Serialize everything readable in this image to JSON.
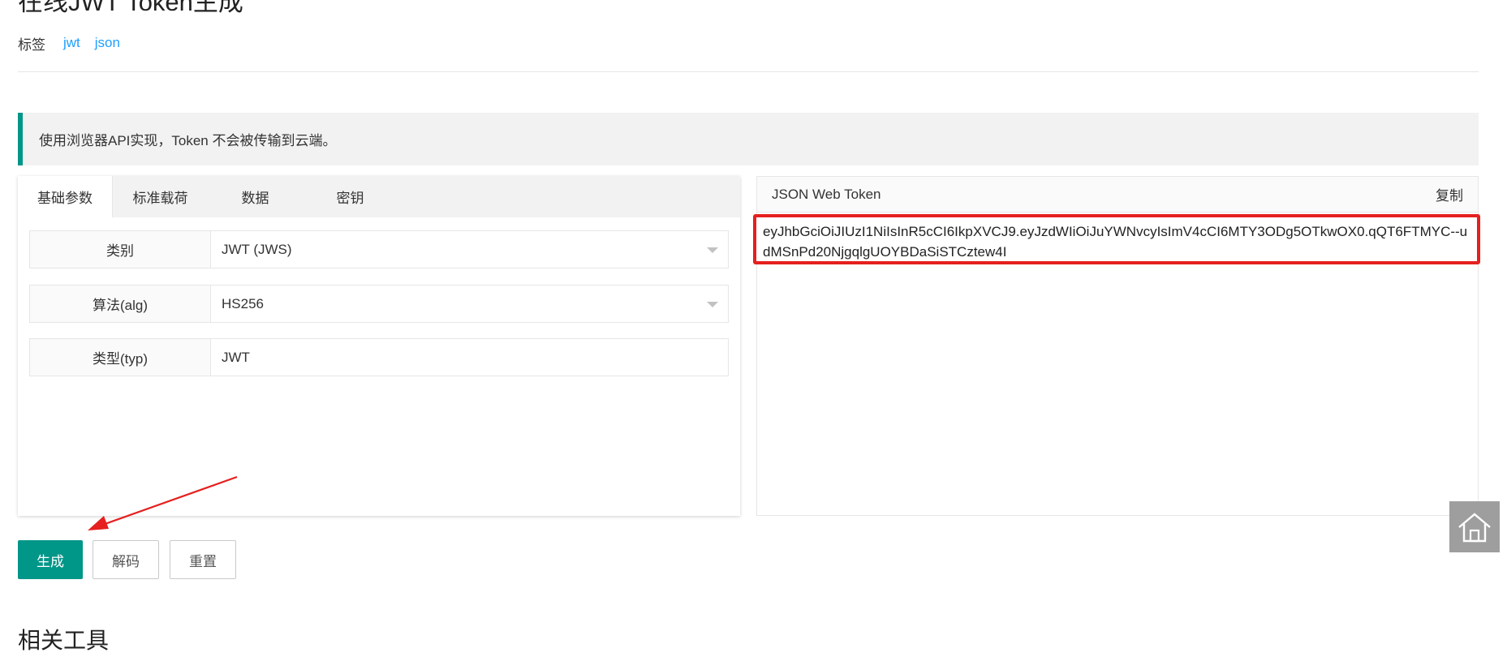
{
  "page": {
    "title": "在线JWT Token生成",
    "tags_label": "标签",
    "tags": [
      "jwt",
      "json"
    ],
    "bottom_heading": "相关工具"
  },
  "notice": {
    "text": "使用浏览器API实现，Token 不会被传输到云端。"
  },
  "tabs": [
    {
      "label": "基础参数",
      "active": true
    },
    {
      "label": "标准载荷",
      "active": false
    },
    {
      "label": "数据",
      "active": false
    },
    {
      "label": "密钥",
      "active": false
    }
  ],
  "form": {
    "type": {
      "label": "类别",
      "value": "JWT (JWS)"
    },
    "algorithm": {
      "label": "算法(alg)",
      "value": "HS256"
    },
    "typ": {
      "label": "类型(typ)",
      "value": "JWT"
    }
  },
  "output": {
    "title": "JSON Web Token",
    "copy_label": "复制",
    "token": "eyJhbGciOiJIUzI1NiIsInR5cCI6IkpXVCJ9.eyJzdWIiOiJuYWNvcyIsImV4cCI6MTY3ODg5OTkwOX0.qQT6FTMYC--udMSnPd20NjgqlgUOYBDaSiSTCztew4I"
  },
  "buttons": {
    "generate": "生成",
    "decode": "解码",
    "reset": "重置"
  },
  "colors": {
    "primary": "#009688",
    "link": "#1e9fff",
    "highlight_border": "#e5201f",
    "annotation_arrow": "#e5201f"
  },
  "icons": {
    "home": "home-icon",
    "dropdown": "caret-down-icon",
    "annotation": "red-arrow"
  }
}
